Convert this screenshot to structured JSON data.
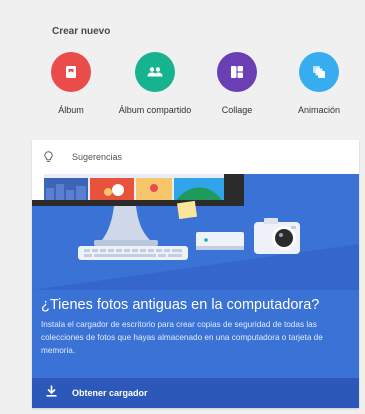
{
  "create_new": {
    "title": "Crear nuevo",
    "items": [
      {
        "label": "Álbum",
        "icon": "album-icon",
        "color": "#ea4c4c"
      },
      {
        "label": "Álbum compartido",
        "icon": "shared-album-icon",
        "color": "#16b38e"
      },
      {
        "label": "Collage",
        "icon": "collage-icon",
        "color": "#6b3fb4"
      },
      {
        "label": "Animación",
        "icon": "animation-icon",
        "color": "#37adf0"
      }
    ]
  },
  "suggestions": {
    "header_label": "Sugerencias",
    "header_icon": "lightbulb-icon",
    "headline": "¿Tienes fotos antiguas en la computadora?",
    "description": "Instala el cargador de escritorio para crear copias de seguridad de todas las colecciones de fotos que hayas almacenado en una computadora o tarjeta de memoria.",
    "action_label": "Obtener cargador",
    "action_icon": "download-icon"
  },
  "colors": {
    "background": "#f0f0f0",
    "illustration_blue": "#3a72d6",
    "footer_blue": "#2b58b9"
  }
}
